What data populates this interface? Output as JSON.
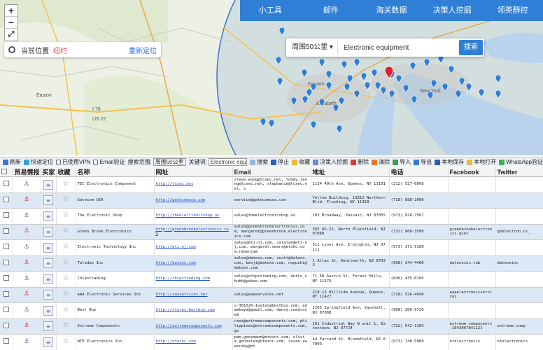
{
  "map": {
    "zoom_in": "+",
    "zoom_out": "−",
    "fullscreen": "⤢",
    "location_label": "当前位置",
    "location_city": "纽约",
    "relocate": "重新定位",
    "place_labels": [
      "Easton",
      "Elizabeth",
      "New York",
      "Newark",
      "I 78",
      "US 22"
    ]
  },
  "topnav": [
    "小工具",
    "邮件",
    "海关数据",
    "决策人挖掘",
    "领英群控"
  ],
  "search": {
    "radius": "周围50公里",
    "keyword": "Electronic equipment",
    "button": "搜索"
  },
  "toolbar": {
    "refresh": "刷新",
    "quick_locate": "快速定位",
    "vpn": "已使用VPN",
    "email_verify": "Email验证",
    "range_label": "搜索范围:",
    "range_value": "周围50公里",
    "keyword_label": "关键词:",
    "keyword_value": "Electronic equ",
    "search": "搜索",
    "stop": "停止",
    "favorite": "收藏",
    "decision_maker": "决策人挖掘",
    "delete": "删除",
    "clear": "清除",
    "import": "导入",
    "export": "导出",
    "save_local": "本地保存",
    "open_local": "本地打开",
    "whatsapp_verify": "WhatsApp验证"
  },
  "columns": [
    "",
    "贸易情报",
    "买家",
    "收藏",
    "名称",
    "网址",
    "Email",
    "地址",
    "电话",
    "Facebook",
    "Twitter"
  ],
  "rows": [
    {
      "name": "TEC Electronics Component",
      "url": "http://tcsec.net",
      "email": "steve.wong@tcsec.net, tommy.leong@tcsec.net, stephanie@tcsec.net, s",
      "address": "1134 49th Ave, Queens, NY 11101",
      "phone": "(212) 527-6068",
      "facebook": "",
      "twitter": ""
    },
    {
      "name": "Gatecom USA",
      "url": "http://gatecomusa.com",
      "email": "service@gatecomusa.com",
      "address": "Yellow Building, 13812 Northern Blvd, Flushing, NY 11358",
      "phone": "(718) 888-2000",
      "facebook": "",
      "twitter": ""
    },
    {
      "name": "The Electronic Shop",
      "url": "http://theelectronicshop.us",
      "email": "sales@theelectronicshop.us",
      "address": "203 Broadway, Passaic, NJ 07055",
      "phone": "(973) 928-7997",
      "facebook": "",
      "twitter": ""
    },
    {
      "name": "Green Brook Electronics",
      "url": "http://greenbrookelectronics.com",
      "email": "sales@greenbrookelectronics.com, margaret@greenbrook.electronics.com",
      "address": "565 US-22, North Plainfield, NJ 07060",
      "phone": "(732) 968-3500",
      "facebook": "greenbrookelectronics.gset",
      "twitter": "gbelectron.cs_"
    },
    {
      "name": "Electronic Technology Inc",
      "url": "http://eti-nj.com",
      "email": "sales@eti-nj.com, catalan@eti-nj.com, margaret.sears@etikc.com.rebenjam",
      "address": "511 Lyons Ave, Irvington, NJ 07111",
      "phone": "(973) 371-5160",
      "facebook": "",
      "twitter": ""
    },
    {
      "name": "Teledax Inc",
      "url": "http://datexx.com",
      "email": "sales@datexx.com, scott@datexx.com, benji@datexx.com, noguchi@datexx.com",
      "address": "1 Atlas St, Kenilworth, NJ 07033",
      "phone": "(908) 244-4466",
      "facebook": "datexxinc.tab",
      "twitter": "datexxinc"
    },
    {
      "name": "Chipstrading",
      "url": "http://chipstrading.com",
      "email": "sales@chipstrading.com, dutts_shubh@yahoo.com",
      "address": "71-58 Austin St, Forest Hills, NY 11375",
      "phone": "(646) 435-0166",
      "facebook": "",
      "twitter": ""
    },
    {
      "name": "AAA Electronic Services Inc",
      "url": "http://aaaservices.net",
      "email": "sales@aaaservices.net",
      "address": "218-13 Hillside Avenue, Queens, NY 11427",
      "phone": "(718) 526-4040",
      "facebook": "aaaelectronicservices",
      "twitter": ""
    },
    {
      "name": "Best Buy",
      "url": "http://stores.bestbuy.com",
      "email": "s-301526-1sales@bestbuy.com, adamkaya@gmail.com, danny.voedrose@",
      "address": "2265 Springfield Ave, Vauxhall, NJ 07088",
      "phone": "(908) 206-9720",
      "facebook": "",
      "twitter": ""
    },
    {
      "name": "Extreme Components",
      "url": "http://extremecomponents.com",
      "email": "rana@extremecomponents.com, philippines@extremecomponents.com, ge",
      "address": "161 Industrial Way W unit 1, Eatontown, NJ 07724",
      "phone": "(732) 542-1165",
      "facebook": "extreme-components-1643067841121",
      "twitter": "extreme_comp"
    },
    {
      "name": "NTE Electronics Inc.",
      "url": "http://nteinc.com",
      "email": "pam.goesmann@nteinc.com, olivia.gonzalez@nteinc.com, susan.zweerzky@nt",
      "address": "44 Farrand St, Bloomfield, NJ 07003",
      "phone": "(973) 748-5089",
      "facebook": "ntelectronics",
      "twitter": "ntelectronics"
    }
  ],
  "colors": {
    "accent": "#2f7fd6",
    "row_alt": "#dde8f6",
    "marker": "#2f7fd6",
    "marker_center": "#d8262e"
  }
}
